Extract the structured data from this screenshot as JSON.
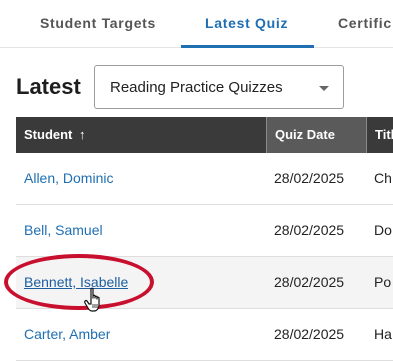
{
  "tabs": [
    {
      "label": "Student Targets"
    },
    {
      "label": "Latest Quiz"
    },
    {
      "label": "Certific"
    }
  ],
  "filter": {
    "label": "Latest",
    "selected": "Reading Practice Quizzes"
  },
  "table": {
    "columns": [
      "Student",
      "Quiz Date",
      "Title"
    ],
    "sort_indicator": "↑",
    "rows": [
      {
        "student": "Allen, Dominic",
        "date": "28/02/2025",
        "title": "Ch"
      },
      {
        "student": "Bell, Samuel",
        "date": "28/02/2025",
        "title": "Do"
      },
      {
        "student": "Bennett, Isabelle",
        "date": "28/02/2025",
        "title": "Po"
      },
      {
        "student": "Carter, Amber",
        "date": "28/02/2025",
        "title": "Ha"
      }
    ]
  },
  "colors": {
    "accent": "#1f6fb2",
    "header_bg": "#3a3a3a",
    "highlight": "#c8102e"
  },
  "icons": {
    "select_caret": "chevron-down-icon",
    "cursor": "hand-pointer-icon"
  }
}
